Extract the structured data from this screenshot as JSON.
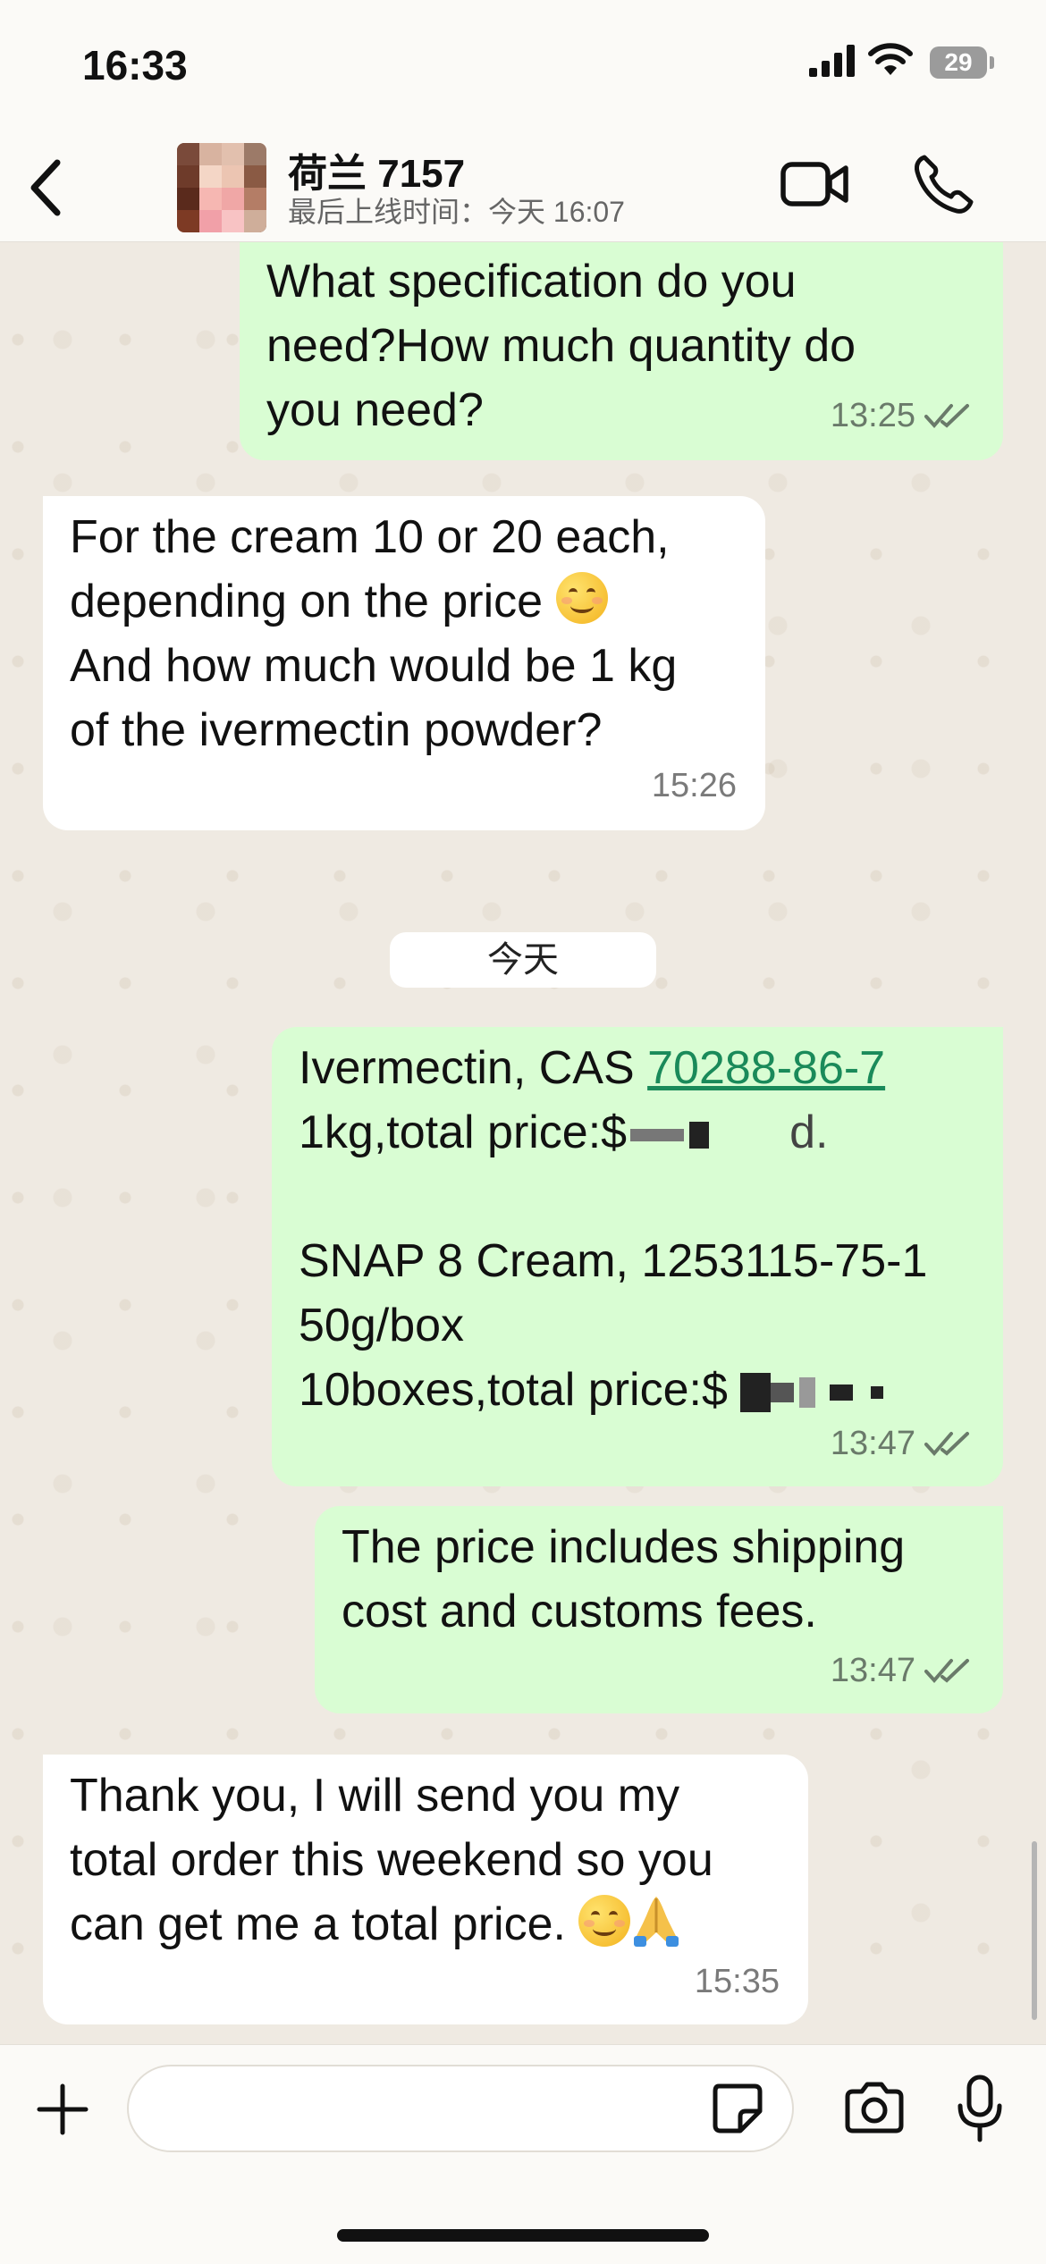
{
  "status_bar": {
    "time": "16:33",
    "battery": "29",
    "icons": [
      "signal-icon",
      "wifi-icon",
      "battery-icon"
    ]
  },
  "header": {
    "back_icon": "chevron-left-icon",
    "contact_name": "荷兰 7157",
    "last_seen": "最后上线时间：今天 16:07",
    "video_icon": "video-camera-icon",
    "call_icon": "phone-icon"
  },
  "messages": [
    {
      "direction": "out",
      "lines": [
        "What specification do you",
        "need?How much quantity do",
        "you need?"
      ],
      "time": "13:25",
      "status": "read"
    },
    {
      "direction": "in",
      "lines": [
        "For the cream 10 or 20 each,",
        "depending on the price",
        "And how much would be 1 kg",
        "of the ivermectin powder?"
      ],
      "time": "15:26"
    },
    {
      "direction": "date",
      "label": "今天"
    },
    {
      "direction": "out",
      "line1_prefix": "Ivermectin, CAS ",
      "line1_link": "70288-86-7",
      "line2": "1kg,total price:$",
      "line2_suffix": "d.",
      "line4": "SNAP 8 Cream, 1253115-75-1",
      "line5": "50g/box",
      "line6": "10boxes,total price:$",
      "time": "13:47",
      "status": "read"
    },
    {
      "direction": "out",
      "lines": [
        "The price includes shipping",
        "cost and customs fees."
      ],
      "time": "13:47",
      "status": "read"
    },
    {
      "direction": "in",
      "lines": [
        "Thank you, I will send you my",
        "total order this weekend so you",
        "can get me a total price."
      ],
      "time": "15:35"
    }
  ],
  "input_bar": {
    "plus_icon": "plus-icon",
    "message_placeholder": "",
    "sticker_icon": "sticker-icon",
    "camera_icon": "camera-icon",
    "mic_icon": "microphone-icon"
  },
  "colors": {
    "outgoing_bubble": "#d9fdd3",
    "incoming_bubble": "#ffffff",
    "chat_background": "#efeae2",
    "link": "#1a8a5a",
    "read_ticks": "#6a7a6a"
  }
}
